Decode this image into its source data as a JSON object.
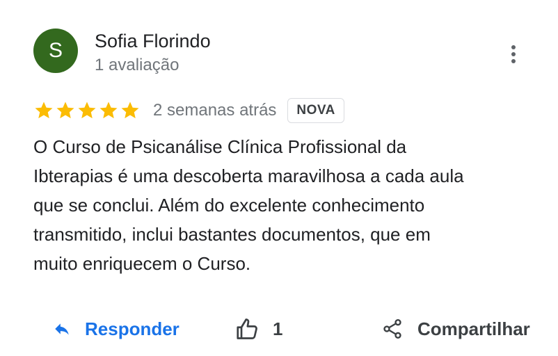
{
  "review": {
    "author": {
      "initial": "S",
      "name": "Sofia Florindo",
      "meta": "1 avaliação",
      "avatar_color": "#33691e"
    },
    "rating": {
      "stars": 5,
      "max": 5,
      "star_color": "#fbbc04"
    },
    "date": "2 semanas atrás",
    "badge": "NOVA",
    "text_lines": [
      "O Curso de Psicanálise Clínica Profissional da",
      "Ibterapias é uma descoberta maravilhosa a cada aula",
      "que se conclui. Além do excelente conhecimento",
      "transmitido, inclui bastantes documentos, que em",
      "muito enriquecem o Curso."
    ]
  },
  "actions": {
    "reply_label": "Responder",
    "like_count": "1",
    "share_label": "Compartilhar",
    "accent_color": "#1a73e8"
  },
  "icons": {
    "more": "more-vert-icon",
    "star": "star-icon",
    "reply": "reply-icon",
    "like": "thumb-up-icon",
    "share": "share-icon"
  }
}
